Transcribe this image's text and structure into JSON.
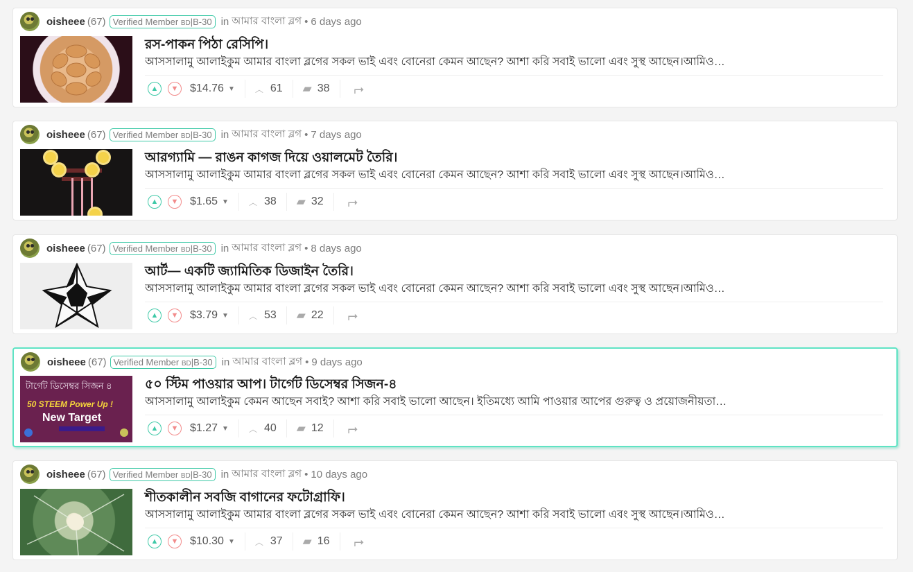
{
  "posts": [
    {
      "author": "oisheee",
      "reputation": "(67)",
      "badge_main": "Verified Member",
      "badge_small": "BD",
      "badge_tail": "|B-30",
      "in_label": "in",
      "community": "আমার বাংলা ব্লগ",
      "bullet": "•",
      "time": "6 days ago",
      "title": "রস-পাকন পিঠা রেসিপি।",
      "excerpt": "আসসালামু আলাইকুম আমার বাংলা ব্লগের সকল ভাই এবং বোনেরা কেমন আছেন? আশা করি সবাই ভালো এবং সুস্থ আছেন।আমিও…",
      "payout": "$14.76",
      "votes": "61",
      "comments": "38",
      "thumb": "pitha"
    },
    {
      "author": "oisheee",
      "reputation": "(67)",
      "badge_main": "Verified Member",
      "badge_small": "BD",
      "badge_tail": "|B-30",
      "in_label": "in",
      "community": "আমার বাংলা ব্লগ",
      "bullet": "•",
      "time": "7 days ago",
      "title": "আরগ্যামি — রাঙন কাগজ দিয়ে ওয়ালমেট তৈরি।",
      "excerpt": "আসসালামু আলাইকুম আমার বাংলা ব্লগের সকল ভাই এবং বোনেরা কেমন আছেন? আশা করি সবাই ভালো এবং সুস্থ আছেন।আমিও…",
      "payout": "$1.65",
      "votes": "38",
      "comments": "32",
      "thumb": "garland"
    },
    {
      "author": "oisheee",
      "reputation": "(67)",
      "badge_main": "Verified Member",
      "badge_small": "BD",
      "badge_tail": "|B-30",
      "in_label": "in",
      "community": "আমার বাংলা ব্লগ",
      "bullet": "•",
      "time": "8 days ago",
      "title": "আর্ট— একটি জ্যামিতিক ডিজাইন তৈরি।",
      "excerpt": "আসসালামু আলাইকুম আমার বাংলা ব্লগের সকল ভাই এবং বোনেরা কেমন আছেন? আশা করি সবাই ভালো এবং সুস্থ আছেন।আমিও…",
      "payout": "$3.79",
      "votes": "53",
      "comments": "22",
      "thumb": "star"
    },
    {
      "author": "oisheee",
      "reputation": "(67)",
      "badge_main": "Verified Member",
      "badge_small": "BD",
      "badge_tail": "|B-30",
      "in_label": "in",
      "community": "আমার বাংলা ব্লগ",
      "bullet": "•",
      "time": "9 days ago",
      "title": "৫০ স্টিম পাওয়ার আপ। টার্গেট ডিসেম্বর সিজন-৪",
      "excerpt": "আসসালামু আলাইকুম কেমন আছেন সবাই? আশা করি সবাই ভালো আছেন। ইতিমধ্যে আমি পাওয়ার আপের গুরুত্ব ও প্রয়োজনীয়তা…",
      "payout": "$1.27",
      "votes": "40",
      "comments": "12",
      "thumb": "target",
      "thumb_text": {
        "line1": "টার্গেট ডিসেম্বর সিজন ৪",
        "line2": "50 STEEM Power Up !",
        "line3": "New Target"
      },
      "highlight": true
    },
    {
      "author": "oisheee",
      "reputation": "(67)",
      "badge_main": "Verified Member",
      "badge_small": "BD",
      "badge_tail": "|B-30",
      "in_label": "in",
      "community": "আমার বাংলা ব্লগ",
      "bullet": "•",
      "time": "10 days ago",
      "title": "শীতকালীন সবজি বাগানের ফটোগ্রাফি।",
      "excerpt": "আসসালামু আলাইকুম আমার বাংলা ব্লগের সকল ভাই এবং বোনেরা কেমন আছেন? আশা করি সবাই ভালো এবং সুস্থ আছেন।আমিও…",
      "payout": "$10.30",
      "votes": "37",
      "comments": "16",
      "thumb": "cauliflower"
    }
  ],
  "icons": {
    "upvote": "upvote-icon",
    "downvote": "downvote-icon",
    "votes": "chevron-up-icon",
    "comments": "comment-icon",
    "resteem": "resteem-icon"
  },
  "colors": {
    "accent": "#3ec9a7",
    "downvote": "#f28b8b",
    "highlight_border": "#5fe3c4"
  }
}
